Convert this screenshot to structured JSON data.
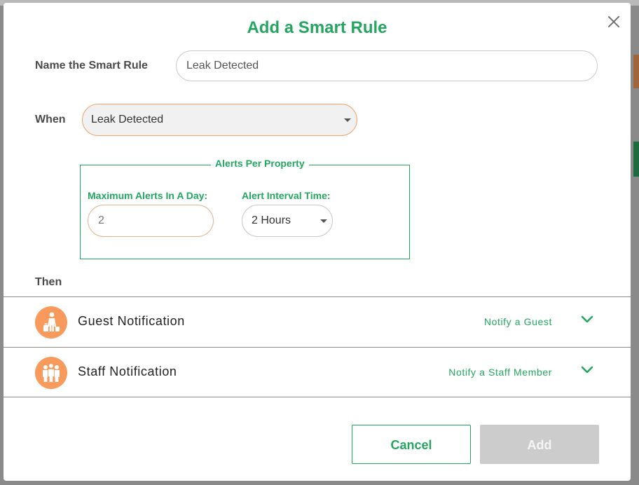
{
  "modal": {
    "title": "Add a Smart Rule",
    "close_icon": "close-icon"
  },
  "name_rule": {
    "label": "Name the Smart Rule",
    "value": "Leak Detected"
  },
  "when": {
    "label": "When",
    "selected": "Leak Detected"
  },
  "alerts": {
    "legend": "Alerts Per Property",
    "max_label": "Maximum Alerts In A Day:",
    "max_value": "2",
    "interval_label": "Alert Interval Time:",
    "interval_selected": "2 Hours"
  },
  "then": {
    "label": "Then",
    "rows": [
      {
        "title": "Guest Notification",
        "action": "Notify a Guest",
        "icon": "guest-icon"
      },
      {
        "title": "Staff Notification",
        "action": "Notify a Staff Member",
        "icon": "staff-icon"
      }
    ]
  },
  "buttons": {
    "cancel": "Cancel",
    "add": "Add"
  },
  "colors": {
    "accent_green": "#23a65f",
    "accent_orange": "#f79a5b",
    "disabled_gray": "#cccccc"
  }
}
